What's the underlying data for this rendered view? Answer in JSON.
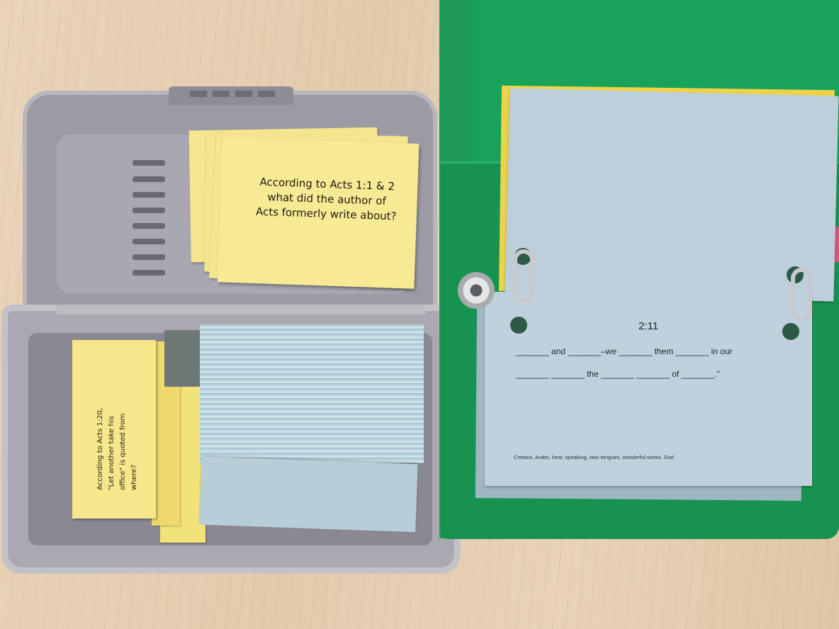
{
  "scene": "photo",
  "colors": {
    "table": "#e6d0b4",
    "box": "#aaa8b0",
    "folder": "#1f9b57",
    "yellow_card": "#f4e58f",
    "blue_card": "#bed1dc"
  },
  "lid_card": {
    "lines": [
      "According to Acts 1:1 & 2",
      "what did the author of",
      "Acts formerly write about?"
    ]
  },
  "side_card": {
    "lines": [
      "According to Acts 1:20,",
      "\"Let another take his",
      "office\" is quoted from",
      "where?"
    ]
  },
  "flip_card": {
    "reference": "2:11",
    "line1": "_______ and _______–we _______ them _______ in our",
    "line2": "_______ _______ the _______ _______ of _______.\"",
    "word_bank": "Cretans, Arabs, hear, speaking, own tongues, wonderful works, God"
  }
}
